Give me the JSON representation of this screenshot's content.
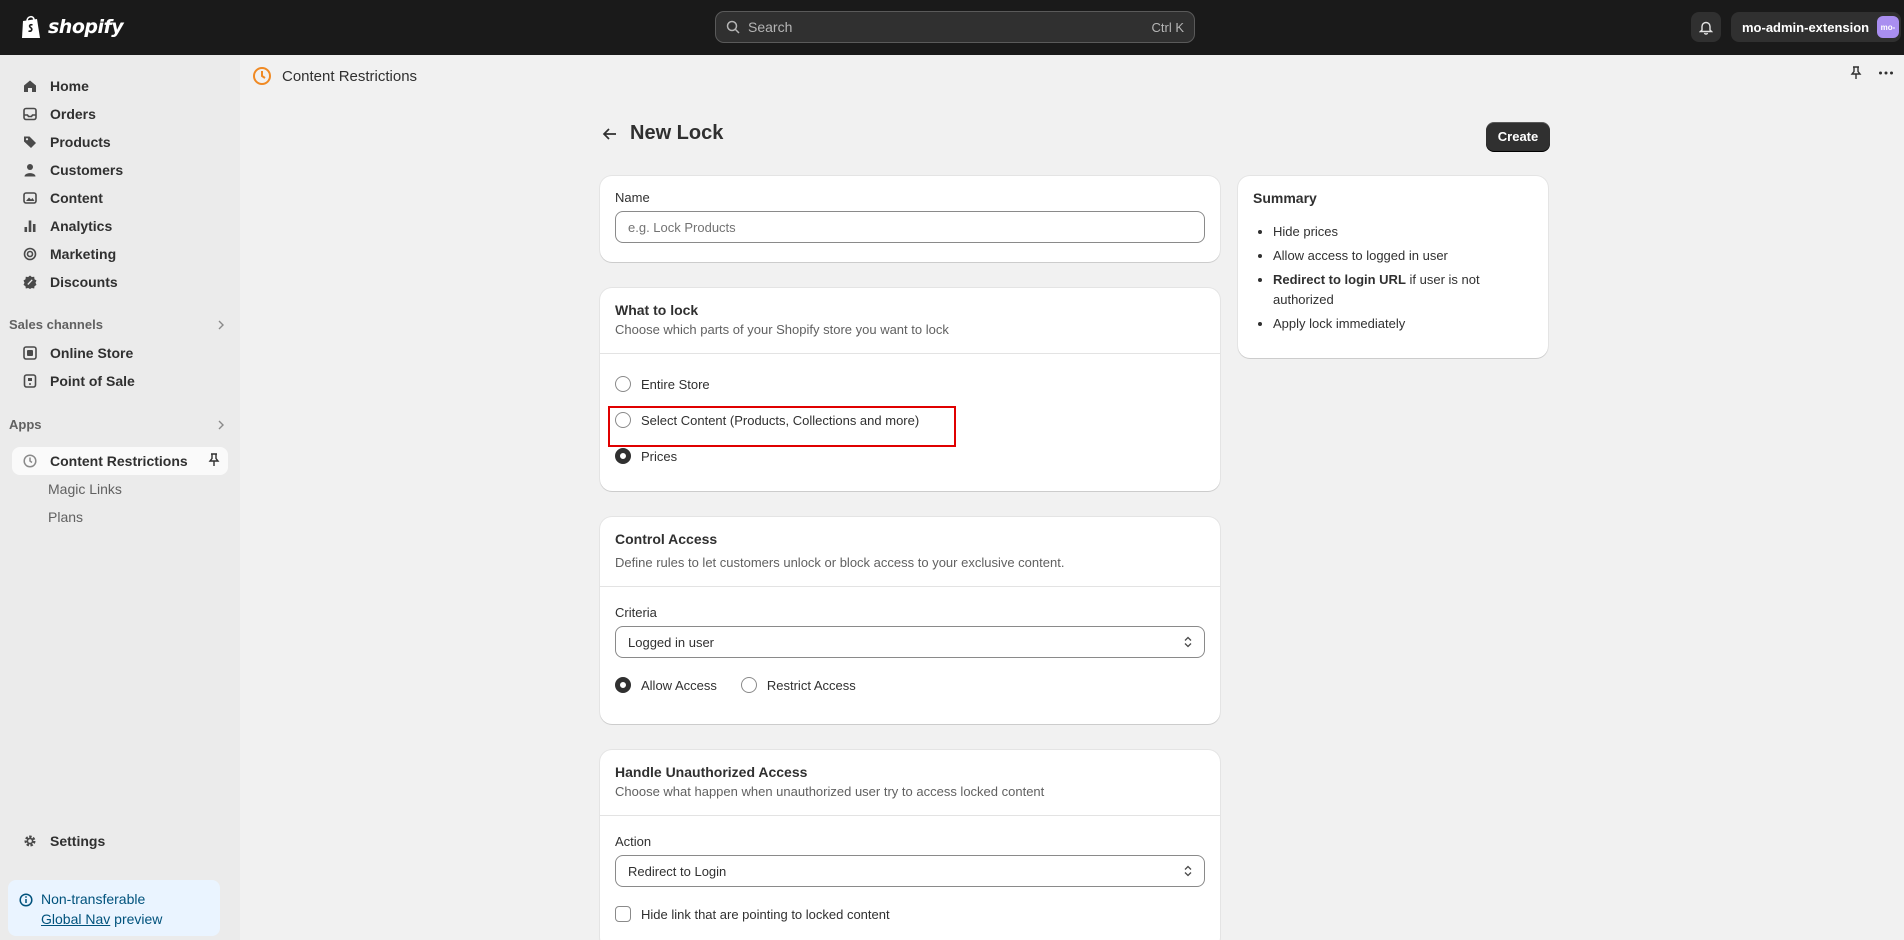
{
  "topbar": {
    "brand": "shopify",
    "search_placeholder": "Search",
    "search_shortcut": "Ctrl K",
    "account_name": "mo-admin-extension",
    "account_avatar": "mo-"
  },
  "sidebar": {
    "items": [
      {
        "label": "Home",
        "icon": "home-icon"
      },
      {
        "label": "Orders",
        "icon": "inbox-icon"
      },
      {
        "label": "Products",
        "icon": "tag-icon"
      },
      {
        "label": "Customers",
        "icon": "person-icon"
      },
      {
        "label": "Content",
        "icon": "image-icon"
      },
      {
        "label": "Analytics",
        "icon": "bar-chart-icon"
      },
      {
        "label": "Marketing",
        "icon": "target-icon"
      },
      {
        "label": "Discounts",
        "icon": "discount-icon"
      }
    ],
    "sales_channels_label": "Sales channels",
    "sales_channels": [
      {
        "label": "Online Store",
        "icon": "store-icon"
      },
      {
        "label": "Point of Sale",
        "icon": "pos-icon"
      }
    ],
    "apps_label": "Apps",
    "app_active": "Content Restrictions",
    "app_subitems": [
      "Magic Links",
      "Plans"
    ],
    "settings_label": "Settings",
    "notice_line1": "Non-transferable",
    "notice_link": "Global Nav",
    "notice_tail": " preview"
  },
  "breadcrumb": {
    "app_name": "Content Restrictions"
  },
  "page": {
    "title": "New Lock",
    "create_label": "Create"
  },
  "name_card": {
    "label": "Name",
    "placeholder": "e.g. Lock Products"
  },
  "lock_card": {
    "title": "What to lock",
    "subtitle": "Choose which parts of your Shopify store you want to lock",
    "options": [
      "Entire Store",
      "Select Content (Products, Collections and more)",
      "Prices"
    ],
    "selected": "Prices"
  },
  "access_card": {
    "title": "Control Access",
    "subtitle": "Define rules to let customers unlock or block access to your exclusive content.",
    "criteria_label": "Criteria",
    "criteria_value": "Logged in user",
    "allow_label": "Allow Access",
    "restrict_label": "Restrict Access",
    "selected": "Allow Access"
  },
  "unauth_card": {
    "title": "Handle Unauthorized Access",
    "subtitle": "Choose what happen when unauthorized user try to access locked content",
    "action_label": "Action",
    "action_value": "Redirect to Login",
    "hide_link_label": "Hide link that are pointing to locked content"
  },
  "summary": {
    "title": "Summary",
    "items": [
      "Hide prices",
      "Allow access to logged in user"
    ],
    "redirect_bold": "Redirect to login URL",
    "redirect_rest": " if user is not authorized",
    "last_item": "Apply lock immediately"
  }
}
